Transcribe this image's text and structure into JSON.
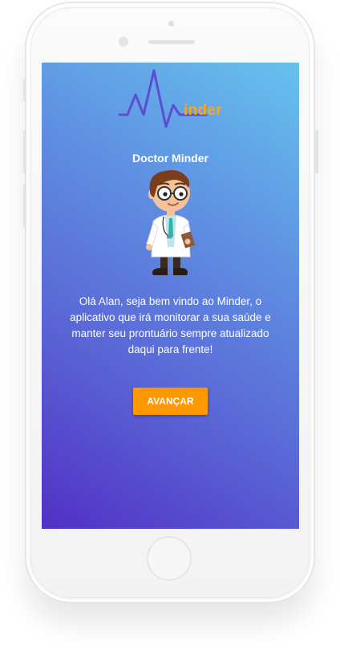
{
  "app": {
    "logo_text": "inder",
    "title": "Doctor Minder",
    "welcome_message": "Olá Alan, seja bem vindo ao Minder, o aplicativo que irá monitorar a sua saúde e manter seu prontuário sempre atualizado daqui para frente!",
    "primary_button_label": "AVANÇAR"
  },
  "icons": {
    "logo": "heartbeat-m-logo",
    "illustration": "doctor-cartoon"
  },
  "colors": {
    "accent": "#ff9800",
    "logo_text": "#f5a623",
    "logo_line": "#5a4fd0",
    "gradient_top": "#66c2ee",
    "gradient_bottom": "#5230c6"
  }
}
